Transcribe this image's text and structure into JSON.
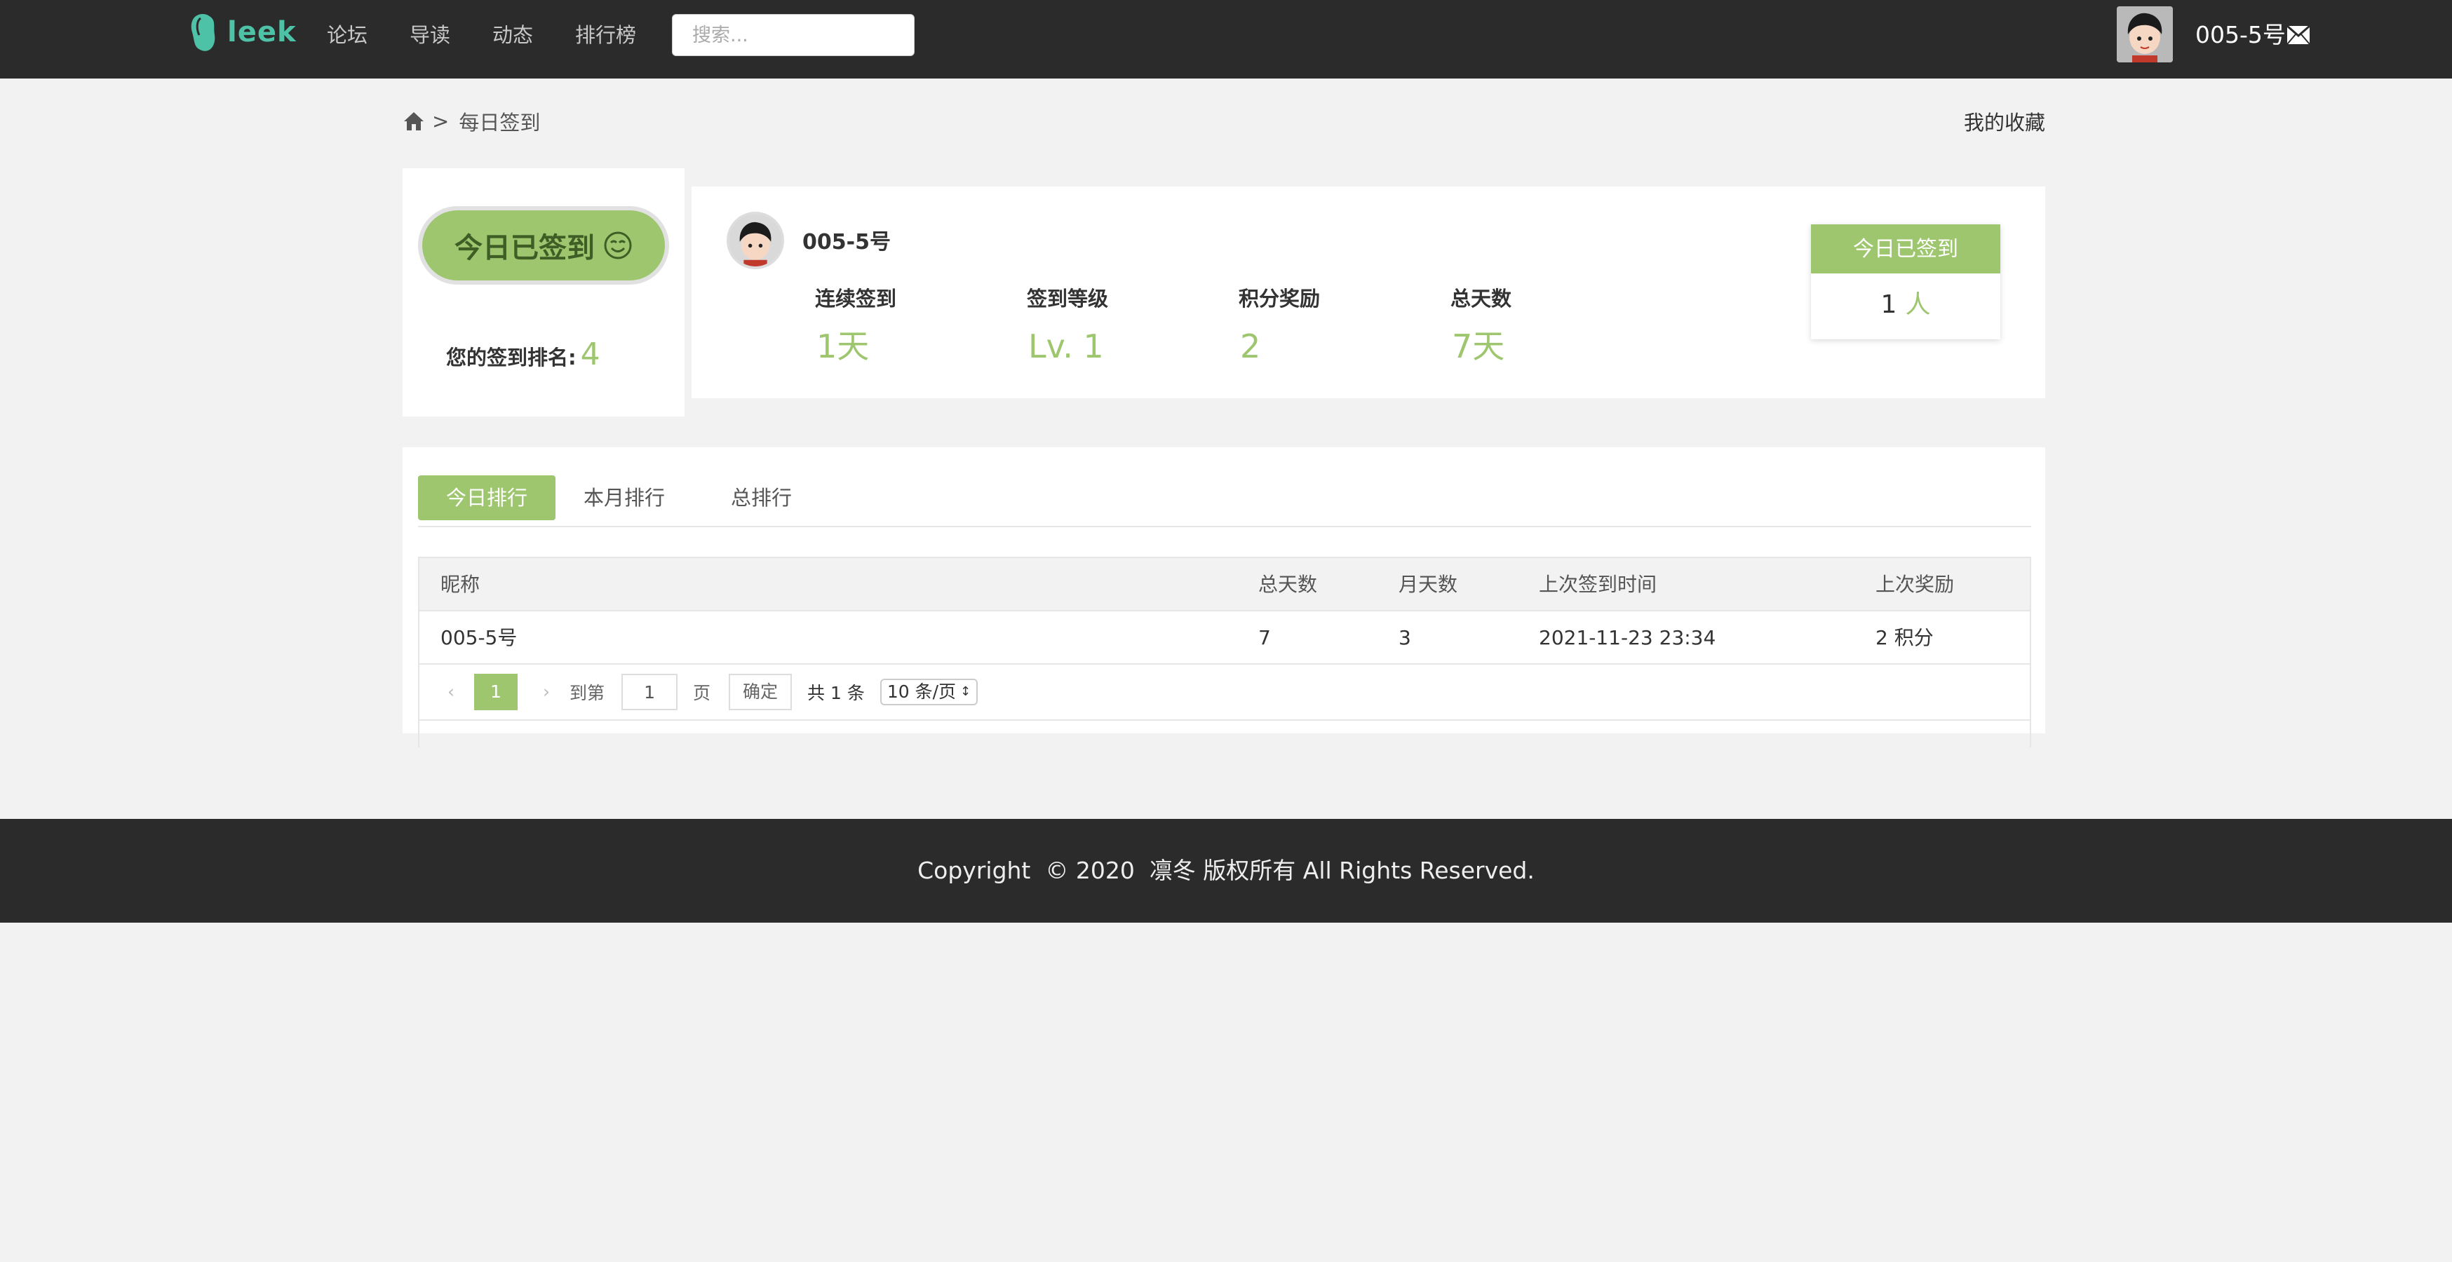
{
  "header": {
    "logo_text": "leek",
    "nav": [
      "论坛",
      "导读",
      "动态",
      "排行榜"
    ],
    "search_placeholder": "搜索...",
    "username": "005-5号"
  },
  "breadcrumb": {
    "current": "每日签到",
    "separator": ">",
    "favorites": "我的收藏"
  },
  "sign_card": {
    "button_label": "今日已签到",
    "rank_label": "您的签到排名:",
    "rank_value": "4",
    "user_name": "005-5号",
    "stats": [
      {
        "label": "连续签到",
        "value": "1天"
      },
      {
        "label": "签到等级",
        "value": "Lv. 1"
      },
      {
        "label": "积分奖励",
        "value": "2"
      },
      {
        "label": "总天数",
        "value": "7天"
      }
    ],
    "today_title": "今日已签到",
    "today_count": "1",
    "today_unit": "人"
  },
  "ranking": {
    "tabs": [
      "今日排行",
      "本月排行",
      "总排行"
    ],
    "active_tab": "今日排行",
    "columns": [
      "昵称",
      "总天数",
      "月天数",
      "上次签到时间",
      "上次奖励"
    ],
    "rows": [
      [
        "005-5号",
        "7",
        "3",
        "2021-11-23 23:34",
        "2 积分"
      ]
    ],
    "pager": {
      "current_page": "1",
      "goto_label": "到第",
      "goto_value": "1",
      "page_label": "页",
      "confirm_label": "确定",
      "total": "共 1 条",
      "page_size": "10 条/页"
    }
  },
  "footer": {
    "text": "Copyright  © 2020  凛冬 版权所有 All Rights Reserved."
  },
  "colors": {
    "accent": "#9dc66e",
    "topbar": "#2b2b2b",
    "logo": "#4ec2a6"
  }
}
